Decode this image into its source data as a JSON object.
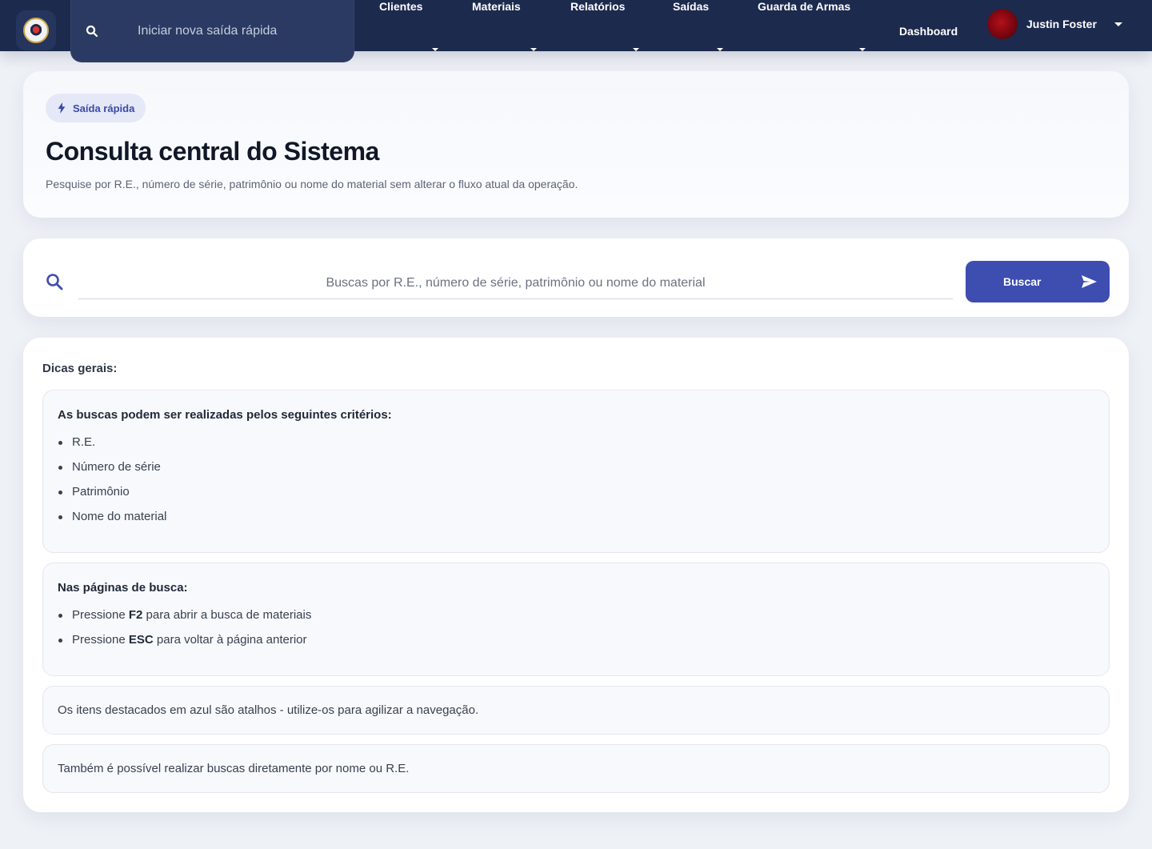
{
  "topbar": {
    "quick_search_placeholder": "Iniciar nova saída rápida",
    "nav": [
      {
        "label": "Clientes"
      },
      {
        "label": "Materiais"
      },
      {
        "label": "Relatórios"
      },
      {
        "label": "Saídas"
      },
      {
        "label": "Guarda de Armas"
      }
    ],
    "dashboard_label": "Dashboard",
    "user_name": "Justin Foster",
    "brand_color": "#1c2a4e"
  },
  "hero": {
    "badge": "Saída rápida",
    "title": "Consulta central do Sistema",
    "subtitle": "Pesquise por R.E., número de série, patrimônio ou nome do material sem alterar o fluxo atual da operação."
  },
  "search": {
    "placeholder": "Buscas por R.E., número de série, patrimônio ou nome do material",
    "value": "",
    "button_label": "Buscar",
    "accent_color": "#3d4db0"
  },
  "tips": {
    "title": "Dicas gerais:",
    "criteria": {
      "heading": "As buscas podem ser realizadas pelos seguintes critérios:",
      "items": [
        "R.E.",
        "Número de série",
        "Patrimônio",
        "Nome do material"
      ]
    },
    "search_pages": {
      "heading": "Nas páginas de busca:",
      "items": [
        {
          "prefix": "Pressione ",
          "key": "F2",
          "suffix": " para abrir a busca de materiais"
        },
        {
          "prefix": "Pressione ",
          "key": "ESC",
          "suffix": " para voltar à página anterior"
        }
      ]
    },
    "shortcut_note": "Os itens destacados em azul são atalhos - utilize-os para agilizar a navegação.",
    "direct_note": "Também é possível realizar buscas diretamente por nome ou R.E."
  }
}
